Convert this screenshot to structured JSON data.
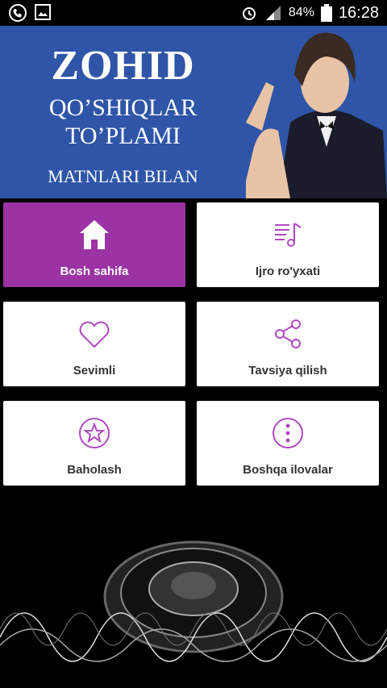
{
  "status": {
    "battery": "84%",
    "time": "16:28"
  },
  "banner": {
    "line1": "ZOHID",
    "line2": "QO’SHIQLAR",
    "line3": "TO’PLAMI",
    "line4": "MATNLARI BILAN"
  },
  "menu": {
    "home": "Bosh sahifa",
    "playlist": "Ijro ro'yxati",
    "favorites": "Sevimli",
    "share": "Tavsiya qilish",
    "rate": "Baholash",
    "more_apps": "Boshqa ilovalar"
  },
  "colors": {
    "accent": "#9b33a4",
    "icon": "#b04ac0",
    "banner": "#2f55a8"
  }
}
